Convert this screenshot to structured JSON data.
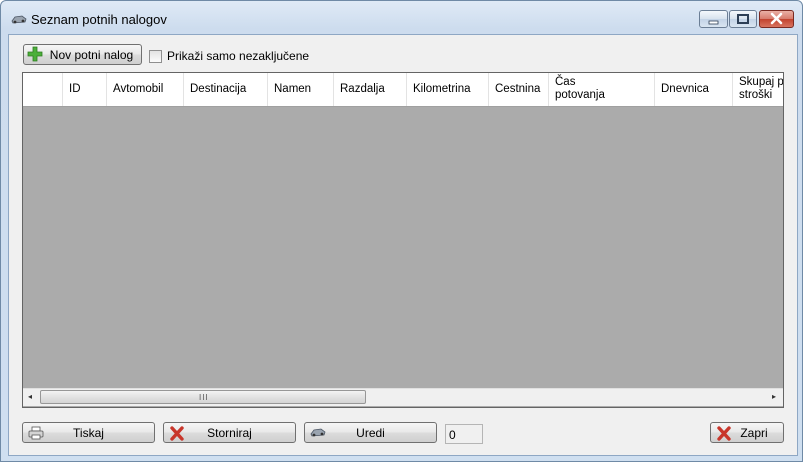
{
  "window": {
    "title": "Seznam potnih nalogov",
    "title_icon": "car-icon",
    "controls": [
      "minimize",
      "maximize",
      "close"
    ]
  },
  "toolbar": {
    "new_button_label": "Nov potni nalog",
    "new_button_icon": "add-icon",
    "filter_checkbox_label": "Prikaži samo nezaključene",
    "filter_checked": false
  },
  "grid": {
    "columns": [
      {
        "label": ""
      },
      {
        "label": "ID"
      },
      {
        "label": "Avtomobil"
      },
      {
        "label": "Destinacija"
      },
      {
        "label": "Namen"
      },
      {
        "label": "Razdalja"
      },
      {
        "label": "Kilometrina"
      },
      {
        "label": "Cestnina"
      },
      {
        "label": "Čas\npotovanja"
      },
      {
        "label": "Dnevnica"
      },
      {
        "label": "Skupaj po\nstroški"
      }
    ],
    "rows": [],
    "scroll_left_glyph": "◂",
    "scroll_right_glyph": "▸",
    "scroll_grip_glyph": "III"
  },
  "footer": {
    "print_label": "Tiskaj",
    "print_icon": "printer-icon",
    "cancel_label": "Storniraj",
    "cancel_icon": "red-x-icon",
    "edit_label": "Uredi",
    "edit_icon": "car-icon",
    "count": "0",
    "close_label": "Zapri",
    "close_icon": "red-x-icon"
  },
  "colors": {
    "grid_background": "#ababab",
    "accent_green": "#3a9b2c",
    "accent_red": "#c8362b"
  }
}
